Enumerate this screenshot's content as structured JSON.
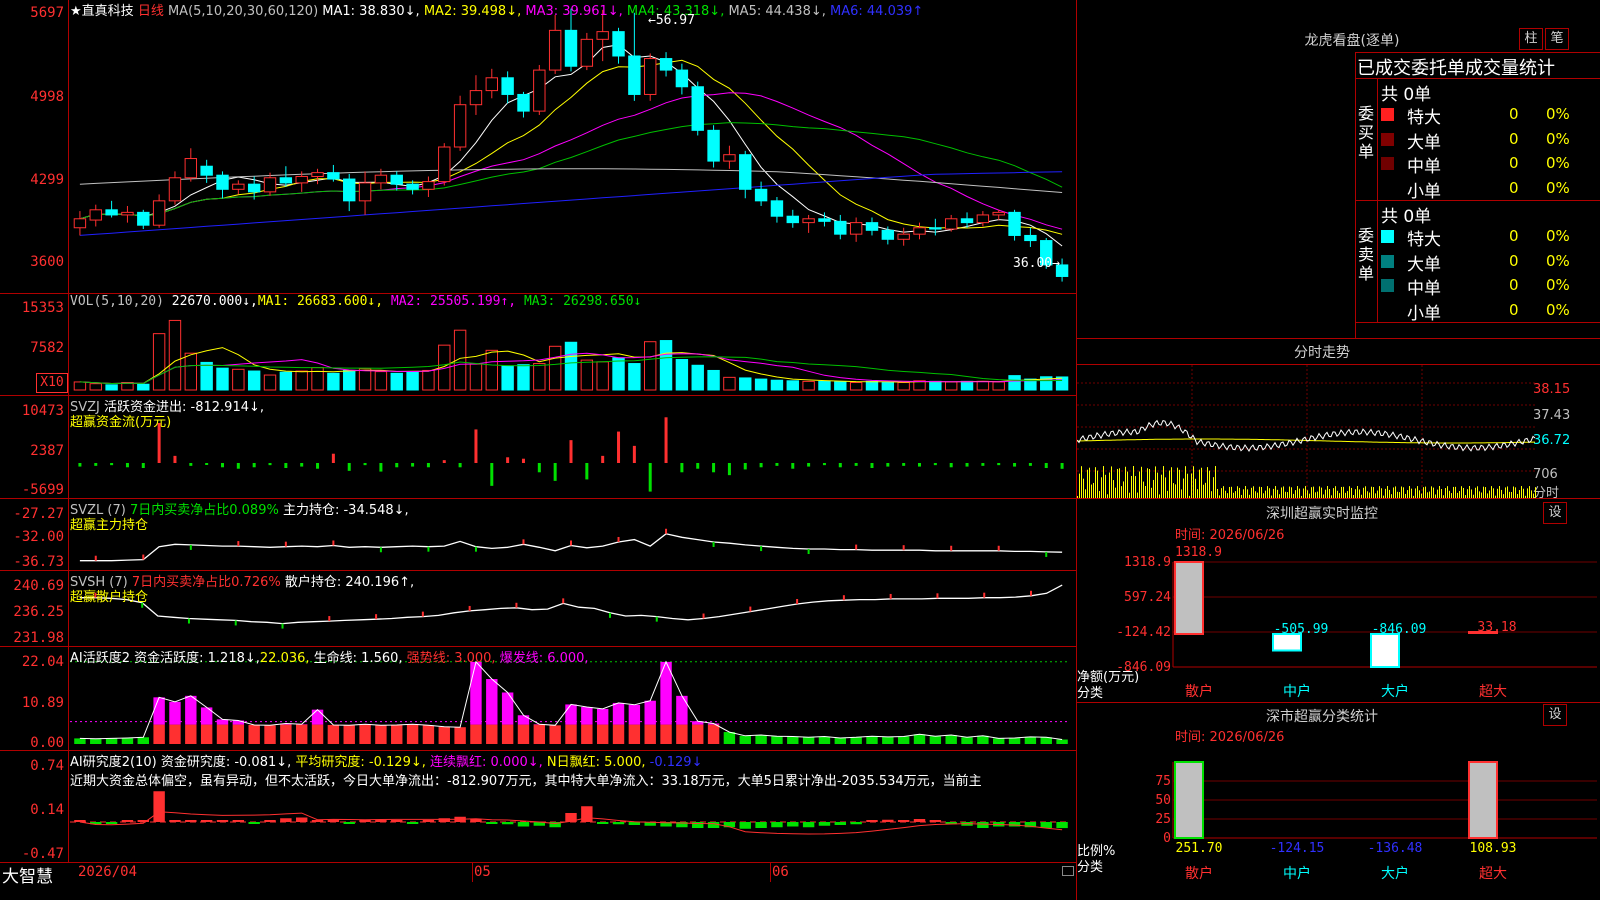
{
  "colors": {
    "up": "#ff3030",
    "down": "#00ffff",
    "grid": "#b00000",
    "ma1": "#ffffff",
    "ma2": "#ffff00",
    "ma3": "#ff00ff",
    "ma4": "#00c000",
    "ma5": "#c0c0c0",
    "ma6": "#2020ff"
  },
  "main_chart": {
    "star": "★",
    "stock_name": "直真科技",
    "period": "日线",
    "ma_label": "MA(5,10,20,30,60,120)",
    "ma1": "MA1: 38.830↓,",
    "ma2": "MA2: 39.498↓,",
    "ma3": "MA3: 39.961↓,",
    "ma4": "MA4: 43.318↓,",
    "ma5": "MA5: 44.438↓,",
    "ma6": "MA6: 44.039↑",
    "high_mark": "←56.97",
    "low_mark": "36.00→",
    "y_ticks": [
      "5697",
      "4998",
      "4299",
      "3600"
    ]
  },
  "vol_chart": {
    "label": "VOL(5,10,20)",
    "vol": "22670.000↓,",
    "ma1": "MA1: 26683.600↓,",
    "ma2": "MA2: 25505.199↑,",
    "ma3": "MA3: 26298.650↓",
    "y_ticks": [
      "15353",
      "7582"
    ],
    "unit": "X10"
  },
  "svzj": {
    "label": "SVZJ",
    "title": "活跃资金进出: -812.914↓,",
    "subtitle": "超赢资金流(万元)",
    "y_ticks": [
      "10473",
      "2387",
      "-5699"
    ]
  },
  "svzl": {
    "label": "SVZL (7)",
    "t1": "7日内买卖净占比0.089%",
    "t2": "主力持仓: -34.548↓,",
    "subtitle": "超赢主力持仓",
    "y_ticks": [
      "-27.27",
      "-32.00",
      "-36.73"
    ]
  },
  "svsh": {
    "label": "SVSH (7)",
    "t1": "7日内买卖净占比0.726%",
    "t2": "散户持仓: 240.196↑,",
    "subtitle": "超赢散户持仓",
    "y_ticks": [
      "240.69",
      "236.25",
      "231.98"
    ]
  },
  "ai_active": {
    "t1": "AI活跃度2",
    "t2": "资金活跃度: 1.218↓,",
    "t3": "22.036,",
    "t4": "生命线: 1.560,",
    "t5": "强势线: 3.000,",
    "t6": "爆发线: 6.000,",
    "y_ticks": [
      "22.04",
      "10.89",
      "0.00"
    ]
  },
  "ai_research": {
    "t1": "AI研究度2(10)",
    "t2": "资金研究度: -0.081↓,",
    "t3": "平均研究度: -0.129↓,",
    "t4": "连续飘红: 0.000↓,",
    "t5": "N日飘红: 5.000,",
    "t6": "-0.129↓",
    "note": "近期大资金总体偏空，虽有异动，但不太活跃，今日大单净流出：-812.907万元，其中特大单净流入：33.18万元，大单5日累计净出-2035.534万元，当前主",
    "y_ticks": [
      "0.74",
      "0.14",
      "-0.47"
    ]
  },
  "x_axis": {
    "app": "大智慧",
    "labels": [
      "2026/04",
      "05",
      "06"
    ]
  },
  "dragon": {
    "title": "龙虎看盘(逐单)",
    "btn1": "柱",
    "btn2": "笔",
    "header": "已成交委托单成交量统计",
    "buy_label": "委买单",
    "sell_label": "委卖单",
    "buy_total": "共 0单",
    "sell_total": "共 0单",
    "buy_rows": [
      {
        "name": "特大",
        "v": "0",
        "p": "0%",
        "c": "#ff2020"
      },
      {
        "name": "大单",
        "v": "0",
        "p": "0%",
        "c": "#800000"
      },
      {
        "name": "中单",
        "v": "0",
        "p": "0%",
        "c": "#700000"
      },
      {
        "name": "小单",
        "v": "0",
        "p": "0%",
        "c": ""
      }
    ],
    "sell_rows": [
      {
        "name": "特大",
        "v": "0",
        "p": "0%",
        "c": "#00ffff"
      },
      {
        "name": "大单",
        "v": "0",
        "p": "0%",
        "c": "#008080"
      },
      {
        "name": "中单",
        "v": "0",
        "p": "0%",
        "c": "#007070"
      },
      {
        "name": "小单",
        "v": "0",
        "p": "0%",
        "c": ""
      }
    ]
  },
  "intraday": {
    "title": "分时走势",
    "y_ticks": [
      "38.15",
      "37.43",
      "36.72"
    ],
    "vol_tick": "706",
    "vol_label": "分时"
  },
  "monitor": {
    "title": "深圳超赢实时监控",
    "btn": "设",
    "time": "时间: 2026/06/26",
    "y_ticks": [
      "1318.9",
      "597.24",
      "-124.42",
      "-846.09"
    ],
    "ylabel": "净额(万元)",
    "xlabel": "分类",
    "top_value": "1318.9",
    "cats": [
      "散户",
      "中户",
      "大户",
      "超大"
    ],
    "values": [
      1318.9,
      -505.99,
      -846.09,
      33.18
    ],
    "value_labels": [
      "",
      "-505.99",
      "-846.09",
      "33.18"
    ]
  },
  "classify": {
    "title": "深市超赢分类统计",
    "btn": "设",
    "time": "时间: 2026/06/26",
    "y_ticks": [
      "75",
      "50",
      "25",
      "0"
    ],
    "ylabel": "比例%",
    "xlabel": "分类",
    "cats": [
      "散户",
      "中户",
      "大户",
      "超大"
    ],
    "values": [
      251.7,
      -124.15,
      -136.48,
      108.93
    ],
    "value_labels": [
      "251.70",
      "-124.15",
      "-136.48",
      "108.93"
    ]
  },
  "chart_data": [
    {
      "type": "candlestick",
      "title": "直真科技 日线",
      "ma": {
        "MA1": 38.83,
        "MA2": 39.498,
        "MA3": 39.961,
        "MA4": 43.318,
        "MA5": 44.438,
        "MA6": 44.039
      },
      "high": 56.97,
      "low": 36.0,
      "ohlc": [
        [
          40.2,
          41.5,
          39.6,
          40.9
        ],
        [
          40.8,
          42.0,
          40.3,
          41.6
        ],
        [
          41.6,
          42.3,
          41.0,
          41.2
        ],
        [
          41.2,
          41.9,
          40.6,
          41.4
        ],
        [
          41.4,
          41.6,
          40.1,
          40.4
        ],
        [
          40.4,
          42.8,
          40.2,
          42.3
        ],
        [
          42.3,
          44.6,
          42.0,
          44.1
        ],
        [
          44.1,
          46.4,
          43.8,
          45.6
        ],
        [
          45.0,
          45.5,
          43.7,
          44.3
        ],
        [
          44.3,
          44.6,
          42.5,
          43.2
        ],
        [
          43.2,
          43.9,
          42.8,
          43.6
        ],
        [
          43.6,
          44.2,
          42.4,
          43.0
        ],
        [
          43.0,
          44.5,
          42.7,
          44.1
        ],
        [
          44.1,
          45.0,
          43.4,
          43.7
        ],
        [
          43.7,
          44.6,
          43.0,
          44.2
        ],
        [
          44.2,
          44.8,
          43.6,
          44.5
        ],
        [
          44.5,
          45.1,
          43.8,
          44.0
        ],
        [
          44.0,
          44.4,
          41.5,
          42.3
        ],
        [
          42.3,
          44.6,
          41.2,
          43.7
        ],
        [
          43.7,
          44.8,
          43.2,
          44.3
        ],
        [
          44.3,
          44.6,
          43.1,
          43.6
        ],
        [
          43.6,
          43.9,
          42.8,
          43.2
        ],
        [
          43.2,
          44.2,
          42.6,
          43.8
        ],
        [
          43.8,
          46.8,
          43.5,
          46.5
        ],
        [
          46.5,
          50.5,
          46.2,
          49.8
        ],
        [
          49.8,
          52.1,
          49.0,
          50.9
        ],
        [
          50.9,
          52.6,
          50.3,
          51.9
        ],
        [
          51.9,
          52.4,
          49.9,
          50.6
        ],
        [
          50.6,
          50.8,
          48.8,
          49.3
        ],
        [
          49.3,
          52.9,
          49.0,
          52.5
        ],
        [
          52.5,
          56.8,
          52.2,
          55.6
        ],
        [
          55.6,
          57.3,
          52.4,
          52.8
        ],
        [
          52.8,
          55.4,
          52.5,
          54.9
        ],
        [
          54.9,
          57.2,
          53.2,
          55.5
        ],
        [
          55.5,
          55.8,
          53.0,
          53.6
        ],
        [
          53.6,
          56.97,
          50.1,
          50.6
        ],
        [
          50.6,
          53.8,
          50.1,
          53.4
        ],
        [
          53.4,
          53.9,
          52.0,
          52.5
        ],
        [
          52.5,
          53.0,
          50.6,
          51.2
        ],
        [
          51.2,
          51.6,
          47.4,
          47.8
        ],
        [
          47.8,
          48.2,
          44.9,
          45.4
        ],
        [
          45.4,
          46.6,
          44.8,
          45.9
        ],
        [
          45.9,
          46.2,
          42.5,
          43.2
        ],
        [
          43.2,
          43.8,
          41.9,
          42.3
        ],
        [
          42.3,
          42.6,
          40.6,
          41.1
        ],
        [
          41.1,
          41.6,
          40.2,
          40.6
        ],
        [
          40.6,
          41.2,
          39.8,
          40.9
        ],
        [
          40.9,
          41.4,
          40.3,
          40.7
        ],
        [
          40.7,
          41.2,
          39.3,
          39.7
        ],
        [
          39.7,
          41.0,
          39.1,
          40.6
        ],
        [
          40.6,
          41.0,
          39.6,
          40.0
        ],
        [
          40.0,
          40.3,
          38.9,
          39.3
        ],
        [
          39.3,
          40.2,
          38.8,
          39.7
        ],
        [
          39.7,
          40.6,
          39.3,
          40.2
        ],
        [
          40.2,
          40.9,
          39.6,
          40.1
        ],
        [
          40.1,
          41.2,
          39.9,
          40.9
        ],
        [
          40.9,
          41.4,
          40.2,
          40.6
        ],
        [
          40.6,
          41.5,
          40.3,
          41.2
        ],
        [
          41.2,
          41.6,
          40.8,
          41.4
        ],
        [
          41.4,
          41.6,
          39.2,
          39.6
        ],
        [
          39.6,
          40.2,
          38.7,
          39.2
        ],
        [
          39.2,
          39.4,
          37.0,
          37.3
        ],
        [
          37.3,
          37.8,
          36.0,
          36.4
        ]
      ]
    },
    {
      "type": "bar",
      "title": "VOL(5,10,20)",
      "values": [
        1400,
        1100,
        900,
        1300,
        1000,
        9800,
        12100,
        6400,
        4800,
        3800,
        3600,
        3300,
        2600,
        3100,
        3300,
        3900,
        2900,
        3400,
        3700,
        3200,
        2900,
        3100,
        3400,
        7800,
        10400,
        4500,
        6900,
        4200,
        4400,
        4600,
        7600,
        8300,
        5200,
        4900,
        5600,
        4600,
        8400,
        8600,
        5300,
        4300,
        3400,
        2200,
        2100,
        1900,
        1700,
        1600,
        1500,
        1500,
        1400,
        1300,
        1500,
        1400,
        1300,
        1600,
        1500,
        1400,
        1500,
        1500,
        1400,
        2500,
        1900,
        2300,
        2267
      ]
    },
    {
      "type": "bar",
      "title": "SVZJ 活跃资金进出",
      "values": [
        -500,
        -400,
        -300,
        -600,
        -700,
        5600,
        1000,
        -400,
        -200,
        -600,
        -800,
        -600,
        -300,
        -700,
        -500,
        -800,
        1300,
        -1100,
        -300,
        -1200,
        -600,
        -500,
        -600,
        400,
        -600,
        4700,
        -3200,
        800,
        600,
        -1300,
        -2500,
        3200,
        -2300,
        1000,
        4400,
        2400,
        -4000,
        6400,
        -1300,
        -800,
        -1300,
        -1700,
        -900,
        -600,
        -400,
        -800,
        -500,
        -300,
        -600,
        -400,
        -700,
        -500,
        -400,
        -500,
        -300,
        -600,
        -500,
        -400,
        -300,
        -500,
        -400,
        -700,
        -813
      ]
    },
    {
      "type": "line",
      "title": "SVZL 主力持仓",
      "values": [
        -36.0,
        -36.0,
        -36.0,
        -35.9,
        -35.8,
        -33.6,
        -33.2,
        -33.3,
        -33.4,
        -33.5,
        -33.5,
        -33.6,
        -33.7,
        -33.6,
        -33.5,
        -33.6,
        -33.4,
        -33.7,
        -33.6,
        -33.7,
        -33.6,
        -33.5,
        -33.6,
        -33.5,
        -32.7,
        -33.6,
        -33.9,
        -33.7,
        -33.2,
        -33.7,
        -34.3,
        -33.4,
        -33.8,
        -33.5,
        -32.8,
        -32.4,
        -33.5,
        -31.4,
        -32.0,
        -32.4,
        -32.8,
        -33.0,
        -33.3,
        -33.5,
        -33.7,
        -33.9,
        -34.0,
        -34.0,
        -34.1,
        -34.1,
        -34.2,
        -34.2,
        -34.2,
        -34.2,
        -34.3,
        -34.3,
        -34.3,
        -34.3,
        -34.3,
        -34.4,
        -34.4,
        -34.5,
        -34.548
      ]
    },
    {
      "type": "line",
      "title": "SVSH 散户持仓",
      "values": [
        238.2,
        238.2,
        238.1,
        237.9,
        237.4,
        235.3,
        235.1,
        234.9,
        234.8,
        234.7,
        234.6,
        234.4,
        234.3,
        234.1,
        234.3,
        234.4,
        234.5,
        234.6,
        234.7,
        234.8,
        234.9,
        235.1,
        235.2,
        235.4,
        235.8,
        236.1,
        236.3,
        236.5,
        236.6,
        236.3,
        236.4,
        237.3,
        236.7,
        236.5,
        235.8,
        235.3,
        235.4,
        235.2,
        234.9,
        234.7,
        234.9,
        235.2,
        235.6,
        236.0,
        236.4,
        236.8,
        237.2,
        237.5,
        237.7,
        237.8,
        237.9,
        237.9,
        238.0,
        238.0,
        238.0,
        238.1,
        238.1,
        238.1,
        238.2,
        238.2,
        238.3,
        238.5,
        238.9,
        240.196
      ]
    },
    {
      "type": "bar",
      "title": "AI活跃度2",
      "values": [
        1.5,
        1.4,
        1.5,
        1.6,
        1.8,
        12.5,
        11.3,
        12.9,
        9.8,
        6.6,
        6.3,
        5.1,
        5.0,
        5.5,
        5.3,
        9.2,
        5.1,
        5.0,
        5.3,
        5.0,
        5.1,
        5.3,
        5.0,
        4.6,
        4.5,
        22.0,
        17.4,
        13.8,
        7.7,
        5.3,
        5.0,
        10.6,
        9.9,
        9.4,
        11.0,
        10.5,
        11.6,
        22.0,
        12.9,
        6.1,
        5.5,
        3.2,
        2.2,
        2.4,
        2.1,
        2.0,
        1.8,
        2.0,
        1.6,
        1.8,
        2.1,
        1.9,
        2.0,
        2.6,
        2.1,
        2.4,
        1.8,
        2.2,
        1.5,
        1.6,
        1.9,
        1.8,
        1.2
      ]
    },
    {
      "type": "bar",
      "title": "AI研究度2(10)",
      "values": [
        0.0,
        -0.03,
        -0.02,
        0.0,
        0.01,
        0.41,
        0.02,
        0.0,
        0.01,
        0.0,
        0.01,
        -0.02,
        0.0,
        0.05,
        0.06,
        0.01,
        0.04,
        -0.01,
        0.0,
        0.01,
        0.02,
        -0.02,
        0.0,
        0.05,
        0.07,
        0.04,
        -0.02,
        -0.03,
        -0.06,
        -0.05,
        -0.07,
        0.12,
        0.21,
        -0.02,
        -0.03,
        -0.04,
        -0.05,
        -0.06,
        -0.07,
        -0.08,
        -0.08,
        -0.07,
        -0.09,
        -0.08,
        -0.07,
        -0.06,
        -0.07,
        -0.05,
        -0.04,
        -0.03,
        0.01,
        0.03,
        0.02,
        0.04,
        0.0,
        -0.03,
        -0.05,
        -0.08,
        -0.06,
        -0.06,
        -0.07,
        -0.08,
        -0.081
      ]
    },
    {
      "type": "bar",
      "title": "深圳超赢实时监控",
      "categories": [
        "散户",
        "中户",
        "大户",
        "超大"
      ],
      "values": [
        1318.9,
        -505.99,
        -846.09,
        33.18
      ]
    },
    {
      "type": "bar",
      "title": "深市超赢分类统计",
      "categories": [
        "散户",
        "中户",
        "大户",
        "超大"
      ],
      "values": [
        251.7,
        -124.15,
        -136.48,
        108.93
      ]
    }
  ]
}
